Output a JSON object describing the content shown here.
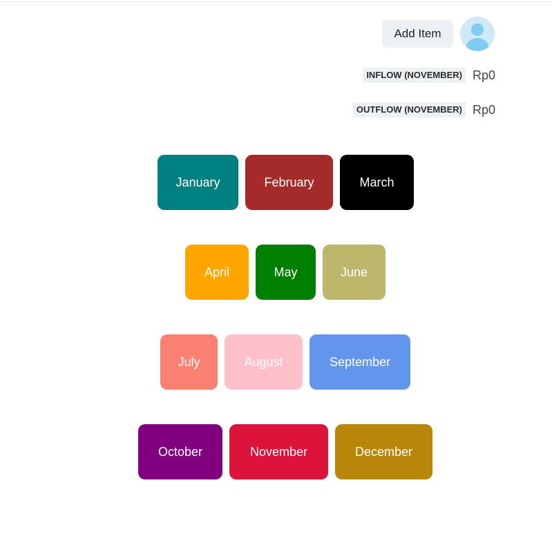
{
  "header": {
    "add_item_label": "Add Item",
    "avatar_icon": "user-avatar-icon"
  },
  "summary": {
    "inflow_label": "INFLOW (NOVEMBER)",
    "inflow_value": "Rp0",
    "outflow_label": "OUTFLOW (NOVEMBER)",
    "outflow_value": "Rp0"
  },
  "months": [
    {
      "label": "January",
      "color": "#008080"
    },
    {
      "label": "February",
      "color": "#a52a2a"
    },
    {
      "label": "March",
      "color": "#000000"
    },
    {
      "label": "April",
      "color": "#ffa500"
    },
    {
      "label": "May",
      "color": "#008000"
    },
    {
      "label": "June",
      "color": "#bdb76b"
    },
    {
      "label": "July",
      "color": "#fa8072"
    },
    {
      "label": "August",
      "color": "#ffc0cb"
    },
    {
      "label": "September",
      "color": "#6495ed"
    },
    {
      "label": "October",
      "color": "#800080"
    },
    {
      "label": "November",
      "color": "#dc143c"
    },
    {
      "label": "December",
      "color": "#b8860b"
    }
  ]
}
